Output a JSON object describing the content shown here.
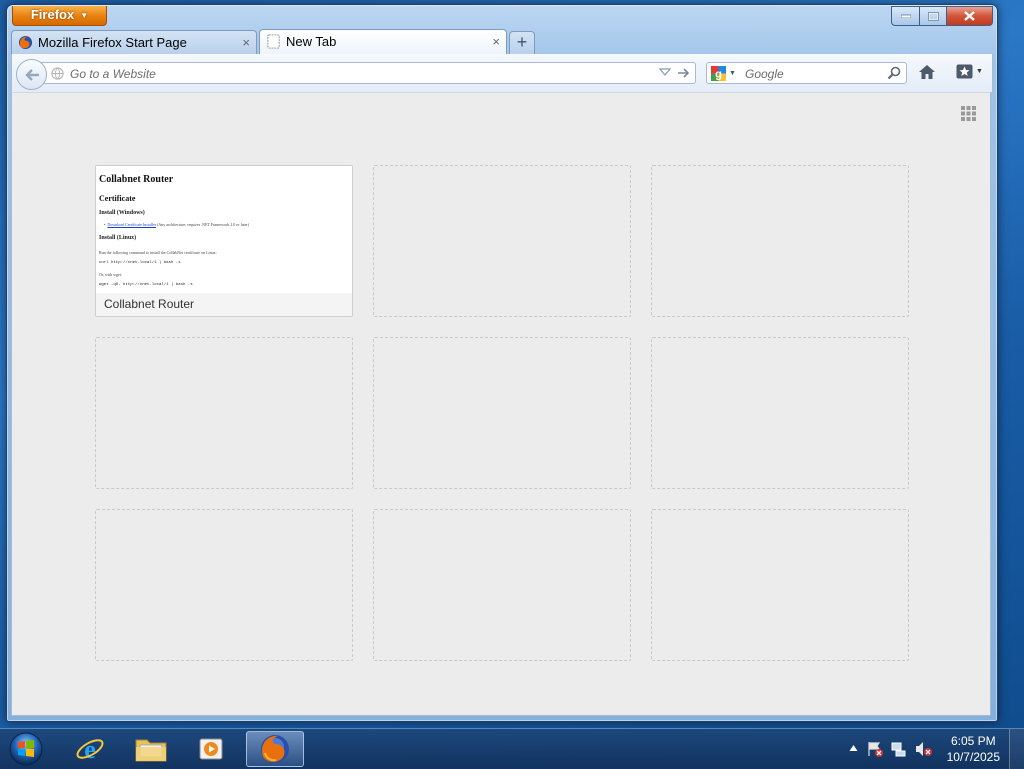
{
  "window": {
    "app_button_label": "Firefox"
  },
  "tabs": [
    {
      "title": "Mozilla Firefox Start Page",
      "favicon": "firefox-icon",
      "active": false
    },
    {
      "title": "New Tab",
      "favicon": "blank-page-icon",
      "active": true
    }
  ],
  "navbar": {
    "url_placeholder": "Go to a Website",
    "search_placeholder": "Google",
    "search_engine": "google-icon"
  },
  "new_tab_page": {
    "tiles": [
      {
        "title": "Collabnet Router",
        "thumbnail": {
          "heading": "Collabnet Router",
          "section": "Certificate",
          "sub1": "Install (Windows)",
          "bullet_link": "Download Certificate Installer",
          "bullet_text": "(Any architecture; requires .NET Framework 2.0 or later)",
          "sub2": "Install (Linux)",
          "para": "Run the following command to install the CollabNet certificate on Linux:",
          "code1": "curl http://cnet.local/1 | bash -s",
          "para2": "Or, with wget:",
          "code2": "wget -qO- http://cnet.local/1 | bash -s"
        }
      }
    ],
    "empty_tile_count": 8
  },
  "taskbar": {
    "pinned": [
      "internet-explorer-icon",
      "windows-explorer-icon",
      "media-player-icon",
      "firefox-icon"
    ],
    "active": "firefox-icon",
    "clock_time": "6:05 PM",
    "clock_date": "10/7/2025"
  },
  "colors": {
    "firefox_orange": "#e8800f",
    "taskbar_blue": "#123a6a",
    "content_bg": "#ececec"
  }
}
